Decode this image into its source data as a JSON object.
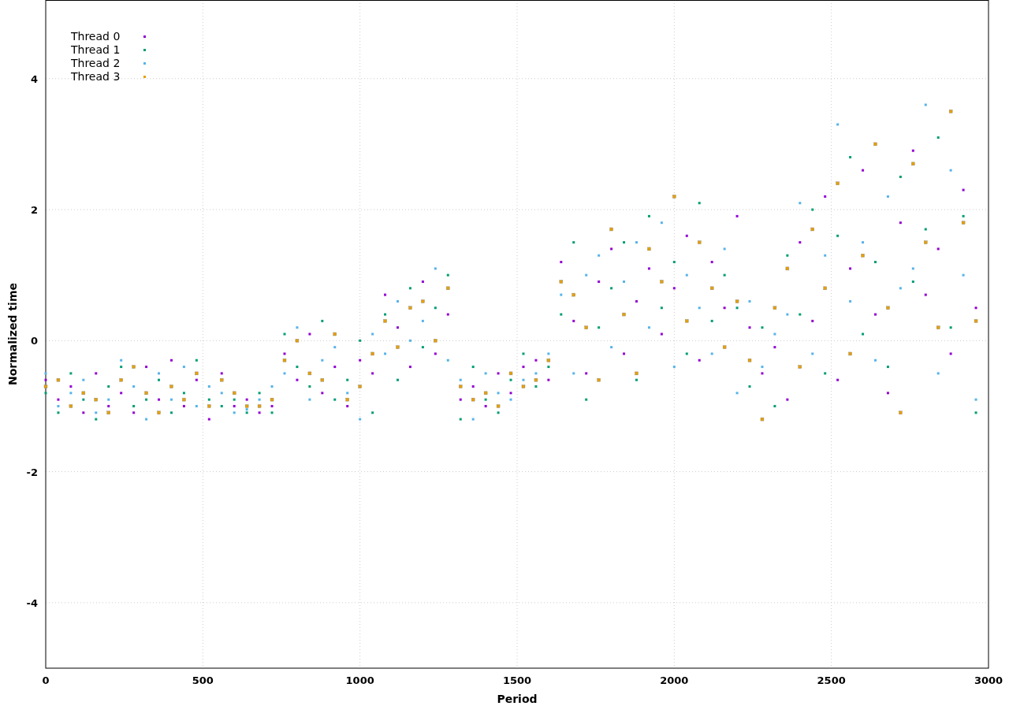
{
  "chart_data": {
    "type": "scatter",
    "xlabel": "Period",
    "ylabel": "Normalized time",
    "xlim": [
      0,
      3000
    ],
    "ylim": [
      -5,
      5.2
    ],
    "xticks": [
      0,
      500,
      1000,
      1500,
      2000,
      2500,
      3000
    ],
    "yticks": [
      -4,
      -2,
      0,
      2,
      4
    ],
    "grid": true,
    "legend": true,
    "x": [
      0,
      40,
      80,
      120,
      160,
      200,
      240,
      280,
      320,
      360,
      400,
      440,
      480,
      520,
      560,
      600,
      640,
      680,
      720,
      760,
      800,
      840,
      880,
      920,
      960,
      1000,
      1040,
      1080,
      1120,
      1160,
      1200,
      1240,
      1280,
      1320,
      1360,
      1400,
      1440,
      1480,
      1520,
      1560,
      1600,
      1640,
      1680,
      1720,
      1760,
      1800,
      1840,
      1880,
      1920,
      1960,
      2000,
      2040,
      2080,
      2120,
      2160,
      2200,
      2240,
      2280,
      2320,
      2360,
      2400,
      2440,
      2480,
      2520,
      2560,
      2600,
      2640,
      2680,
      2720,
      2760,
      2800,
      2840,
      2880,
      2920,
      2960
    ],
    "series": [
      {
        "name": "Thread 0",
        "color": "#9400d3",
        "values": [
          -0.6,
          -0.9,
          -0.7,
          -1.1,
          -0.5,
          -1.0,
          -0.8,
          -1.1,
          -0.4,
          -0.9,
          -0.3,
          -1.0,
          -0.6,
          -1.2,
          -0.5,
          -1.0,
          -0.9,
          -1.1,
          -1.0,
          -0.2,
          -0.6,
          0.1,
          -0.8,
          -0.4,
          -1.0,
          -0.3,
          -0.5,
          0.7,
          0.2,
          -0.4,
          0.9,
          -0.2,
          0.4,
          -0.9,
          -0.7,
          -1.0,
          -0.5,
          -0.8,
          -0.4,
          -0.3,
          -0.6,
          1.2,
          0.3,
          -0.5,
          0.9,
          1.4,
          -0.2,
          0.6,
          1.1,
          0.1,
          0.8,
          1.6,
          -0.3,
          1.2,
          0.5,
          1.9,
          0.2,
          -0.5,
          -0.1,
          -0.9,
          1.5,
          0.3,
          2.2,
          -0.6,
          1.1,
          2.6,
          0.4,
          -0.8,
          1.8,
          2.9,
          0.7,
          1.4,
          -0.2,
          2.3,
          0.5
        ]
      },
      {
        "name": "Thread 1",
        "color": "#009e73",
        "values": [
          -0.8,
          -1.1,
          -0.5,
          -0.9,
          -1.2,
          -0.7,
          -0.4,
          -1.0,
          -0.9,
          -0.6,
          -1.1,
          -0.8,
          -0.3,
          -0.9,
          -1.0,
          -0.9,
          -1.1,
          -0.8,
          -1.1,
          0.1,
          -0.4,
          -0.7,
          0.3,
          -0.9,
          -0.6,
          0.0,
          -1.1,
          0.4,
          -0.6,
          0.8,
          -0.1,
          0.5,
          1.0,
          -1.2,
          -0.4,
          -0.9,
          -1.1,
          -0.6,
          -0.2,
          -0.7,
          -0.4,
          0.4,
          1.5,
          -0.9,
          0.2,
          0.8,
          1.5,
          -0.6,
          1.9,
          0.5,
          1.2,
          -0.2,
          2.1,
          0.3,
          1.0,
          0.5,
          -0.7,
          0.2,
          -1.0,
          1.3,
          0.4,
          2.0,
          -0.5,
          1.6,
          2.8,
          0.1,
          1.2,
          -0.4,
          2.5,
          0.9,
          1.7,
          3.1,
          0.2,
          1.9,
          -1.1
        ]
      },
      {
        "name": "Thread 2",
        "color": "#56b4e9",
        "values": [
          -0.5,
          -1.0,
          -0.8,
          -0.6,
          -1.1,
          -0.9,
          -0.3,
          -0.7,
          -1.2,
          -0.5,
          -0.9,
          -0.4,
          -1.0,
          -0.7,
          -0.8,
          -1.1,
          -1.05,
          -0.9,
          -0.7,
          -0.5,
          0.2,
          -0.9,
          -0.3,
          -0.1,
          -0.8,
          -1.2,
          0.1,
          -0.2,
          0.6,
          0.0,
          0.3,
          1.1,
          -0.3,
          -0.6,
          -1.2,
          -0.5,
          -0.8,
          -0.9,
          -0.6,
          -0.5,
          -0.2,
          0.7,
          -0.5,
          1.0,
          1.3,
          -0.1,
          0.9,
          1.5,
          0.2,
          1.8,
          -0.4,
          1.0,
          0.5,
          -0.2,
          1.4,
          -0.8,
          0.6,
          -0.4,
          0.1,
          0.4,
          2.1,
          -0.2,
          1.3,
          3.3,
          0.6,
          1.5,
          -0.3,
          2.2,
          0.8,
          1.1,
          3.6,
          -0.5,
          2.6,
          1.0,
          -0.9
        ]
      },
      {
        "name": "Thread 3",
        "color": "#e69f00",
        "values": [
          -0.7,
          -0.6,
          -1.0,
          -0.8,
          -0.9,
          -1.1,
          -0.6,
          -0.4,
          -0.8,
          -1.1,
          -0.7,
          -0.9,
          -0.5,
          -1.0,
          -0.6,
          -0.8,
          -1.0,
          -1.0,
          -0.9,
          -0.3,
          0.0,
          -0.5,
          -0.6,
          0.1,
          -0.9,
          -0.7,
          -0.2,
          0.3,
          -0.1,
          0.5,
          0.6,
          0.0,
          0.8,
          -0.7,
          -0.9,
          -0.8,
          -1.0,
          -0.5,
          -0.7,
          -0.6,
          -0.3,
          0.9,
          0.7,
          0.2,
          -0.6,
          1.7,
          0.4,
          -0.5,
          1.4,
          0.9,
          2.2,
          0.3,
          1.5,
          0.8,
          -0.1,
          0.6,
          -0.3,
          -1.2,
          0.5,
          1.1,
          -0.4,
          1.7,
          0.8,
          2.4,
          -0.2,
          1.3,
          3.0,
          0.5,
          -1.1,
          2.7,
          1.5,
          0.2,
          3.5,
          1.8,
          0.3
        ]
      }
    ]
  }
}
